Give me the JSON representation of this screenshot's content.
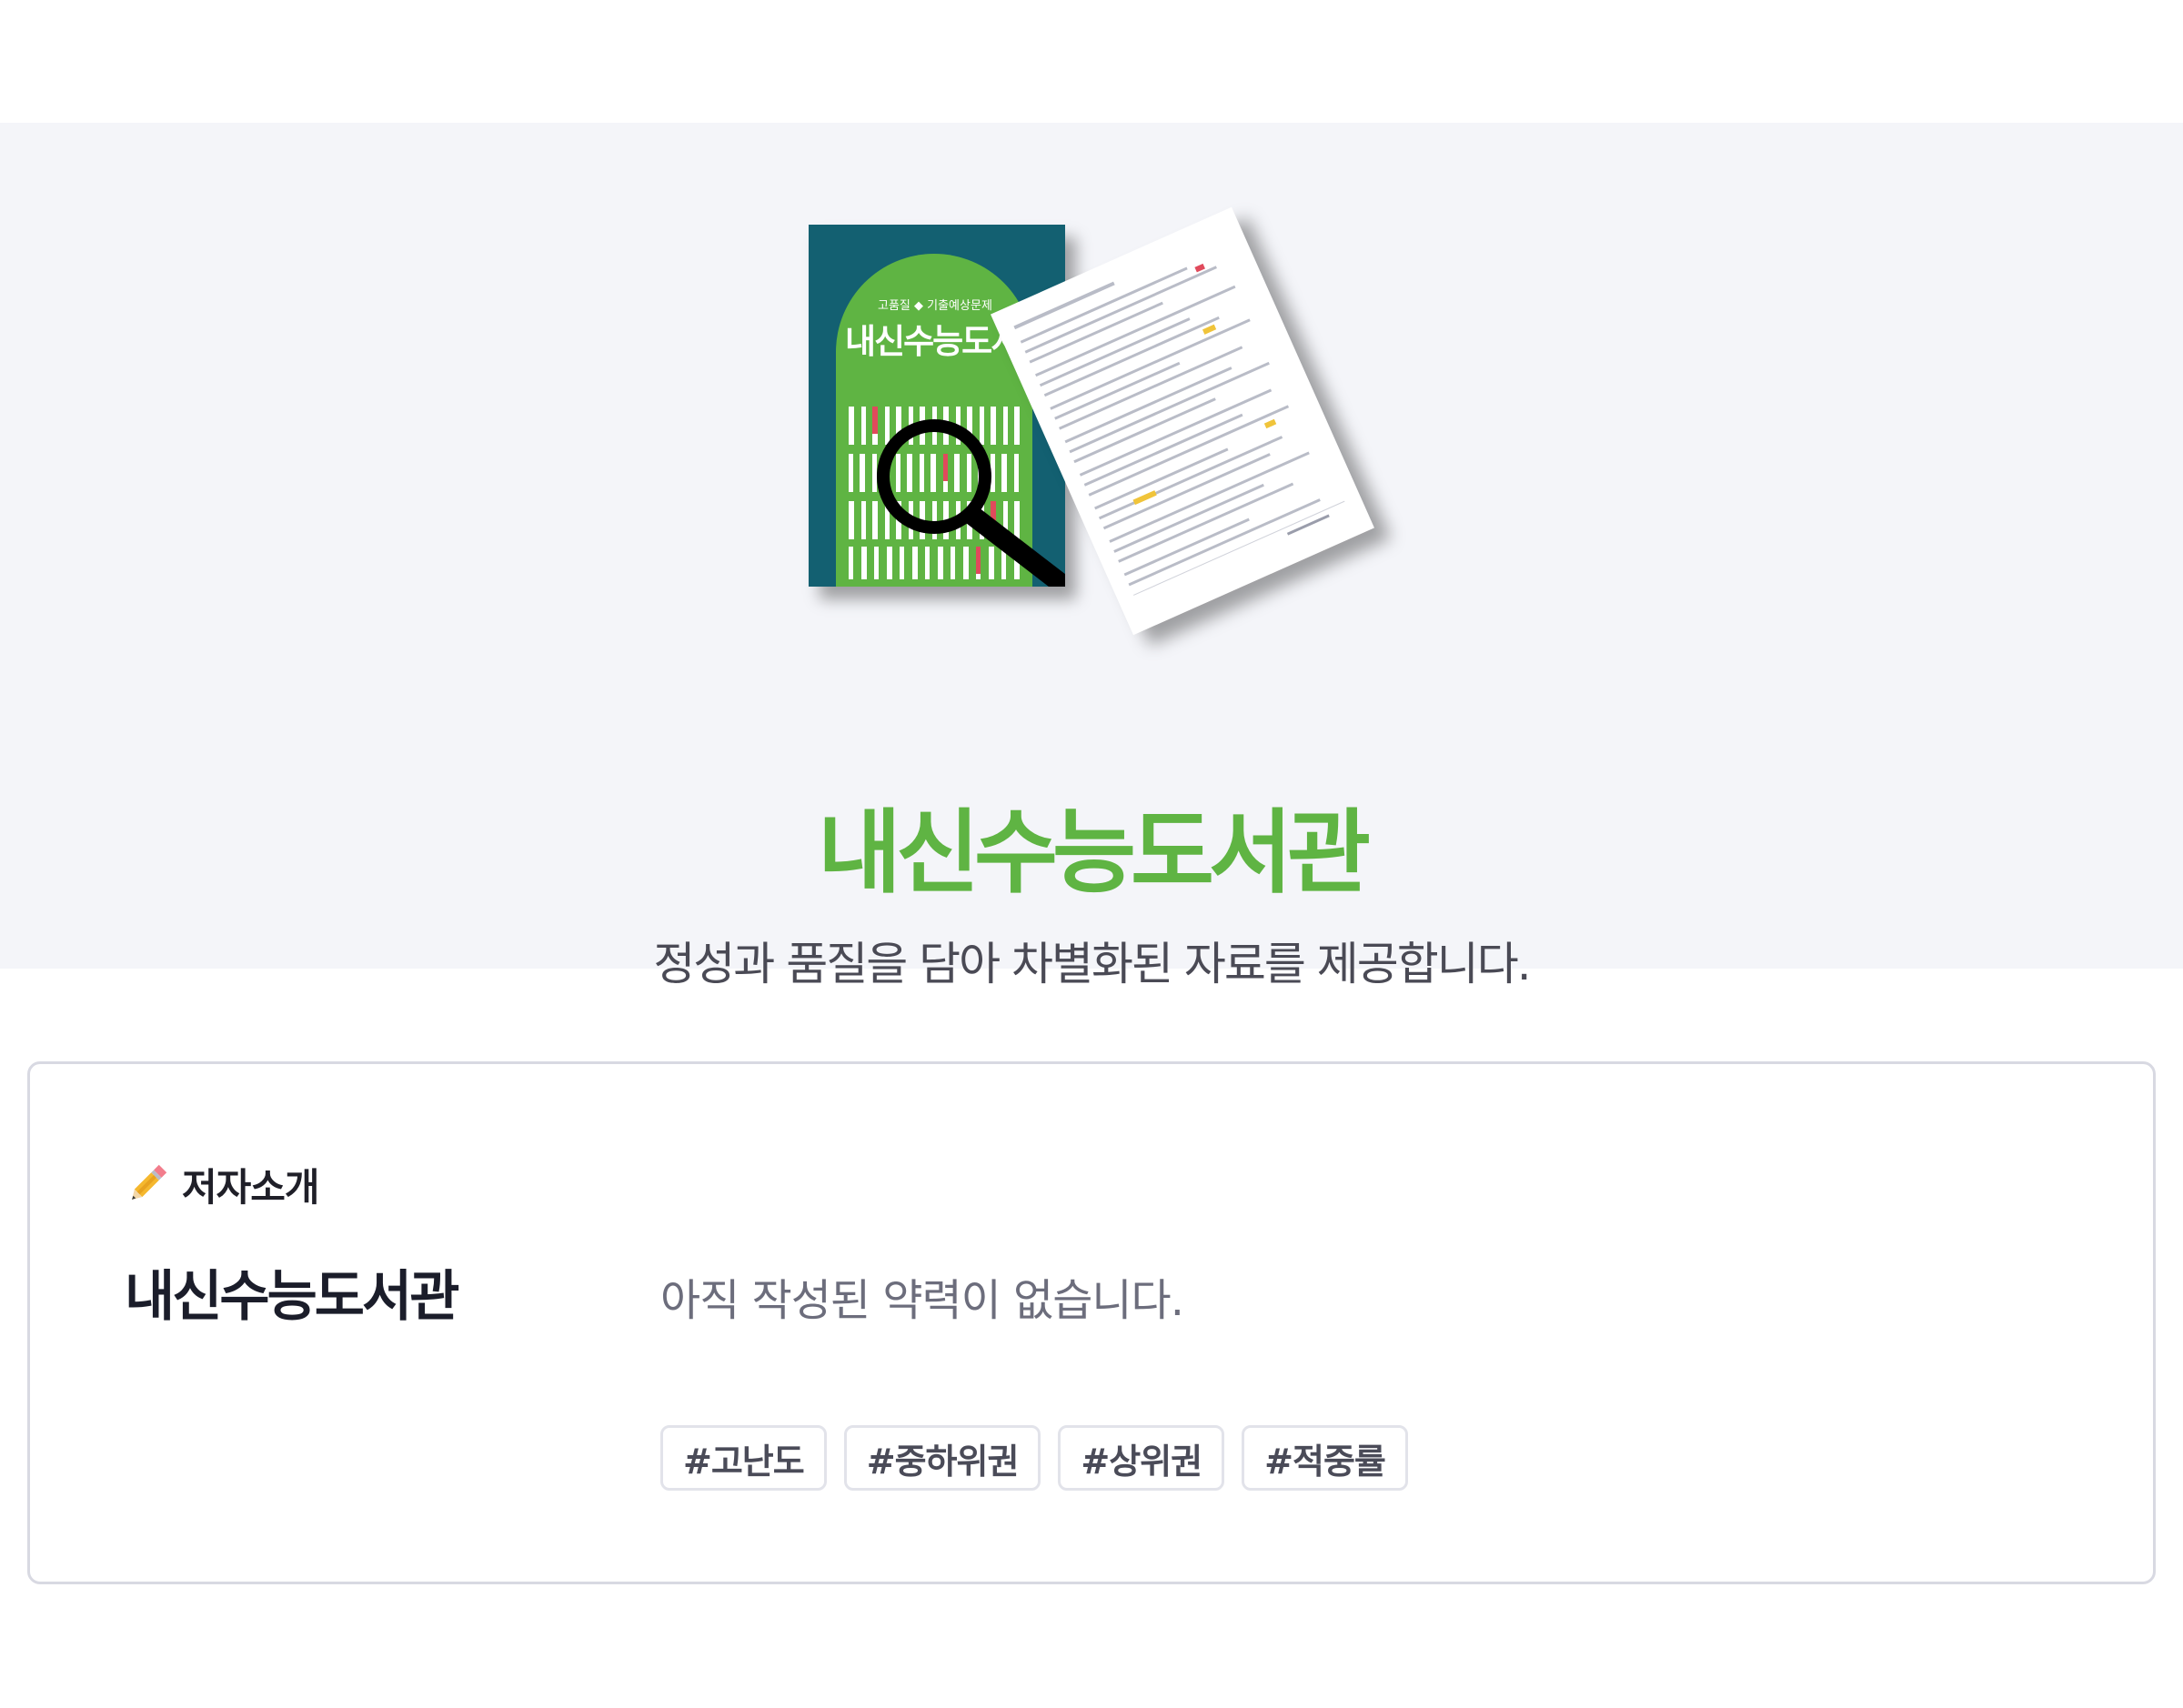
{
  "hero": {
    "book_subtitle": "고품질 ◆ 기출예상문제",
    "book_title": "내신수능도서관",
    "title": "내신수능도서관",
    "tagline": "정성과 품질을 담아 차별화된 자료를 제공합니다.",
    "colors": {
      "background": "#f4f5f9",
      "brand_green": "#5fb443",
      "book_teal": "#136071"
    }
  },
  "author": {
    "section_icon": "pencil-icon",
    "section_title": "저자소개",
    "name": "내신수능도서관",
    "bio": "아직 작성된 약력이 없습니다.",
    "tags": [
      "#고난도",
      "#중하위권",
      "#상위권",
      "#적중률"
    ]
  }
}
